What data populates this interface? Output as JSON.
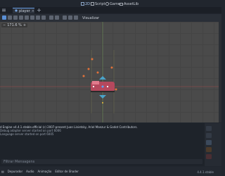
{
  "workspaces": [
    {
      "label": "2D",
      "active": true
    },
    {
      "label": "Script",
      "active": false
    },
    {
      "label": "Game",
      "active": false
    },
    {
      "label": "AssetLib",
      "active": false
    }
  ],
  "tab": {
    "title": "player",
    "close": "×"
  },
  "viewport": {
    "zoom": "171.6 %",
    "menu": "Visualizar"
  },
  "log": [
    "d Engine v4.4.1.stable.official (c) 2007-present Juan Linietsky, Ariel Manzur & Godot Contributors.",
    "Debug adapter server started on port 6006",
    "Language server started on port 6005"
  ],
  "filter_placeholder": "Filtrar Mensagens",
  "bottom_tabs": [
    "Depurador",
    "Audio",
    "Animação",
    "Editor de Shader"
  ],
  "version": "4.4.1.stable",
  "colors": {
    "accent": "#6aa0e6",
    "sprite": "#b5485d",
    "marker": "#e0723a",
    "gizmo": "#4aa3c9"
  }
}
